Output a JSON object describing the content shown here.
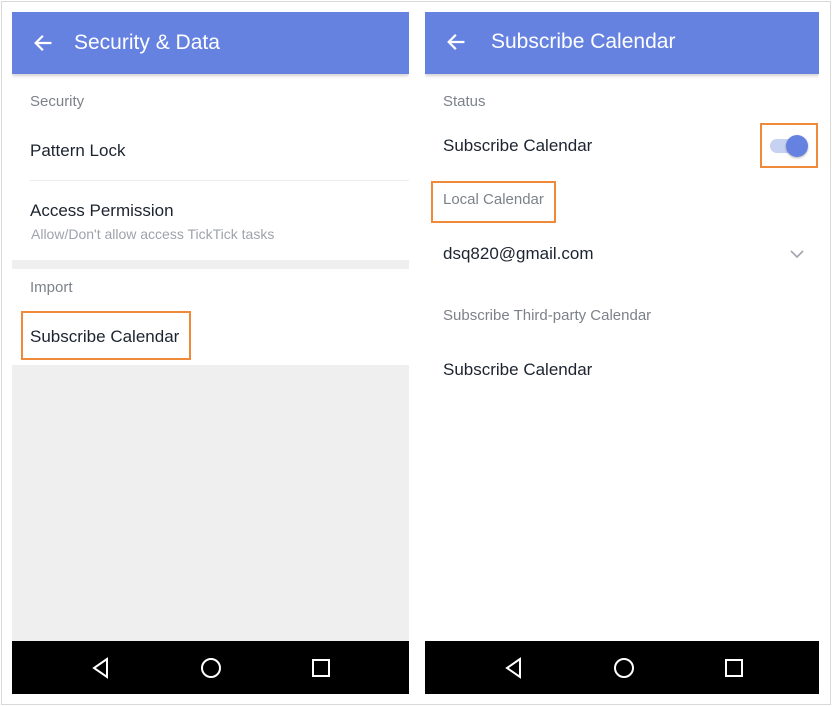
{
  "left_screen": {
    "title": "Security & Data",
    "sections": {
      "security_label": "Security",
      "pattern_lock": "Pattern Lock",
      "access_permission": "Access Permission",
      "access_permission_sub": "Allow/Don't allow access TickTick tasks",
      "import_label": "Import",
      "subscribe_calendar": "Subscribe Calendar"
    }
  },
  "right_screen": {
    "title": "Subscribe Calendar",
    "status_label": "Status",
    "subscribe_toggle_label": "Subscribe Calendar",
    "subscribe_toggle_on": true,
    "local_calendar_label": "Local Calendar",
    "account_email": "dsq820@gmail.com",
    "third_party_label": "Subscribe Third-party Calendar",
    "third_party_item": "Subscribe Calendar"
  },
  "icons": {
    "back": "arrow-left-icon",
    "nav_back": "triangle-back-icon",
    "nav_home": "circle-home-icon",
    "nav_recents": "square-recents-icon",
    "dropdown": "chevron-down-icon"
  },
  "colors": {
    "appbar": "#6582e1",
    "highlight": "#ef8a3a",
    "toggle_thumb": "#6582e1",
    "toggle_track": "#c7d1f2",
    "navbar": "#000000"
  }
}
